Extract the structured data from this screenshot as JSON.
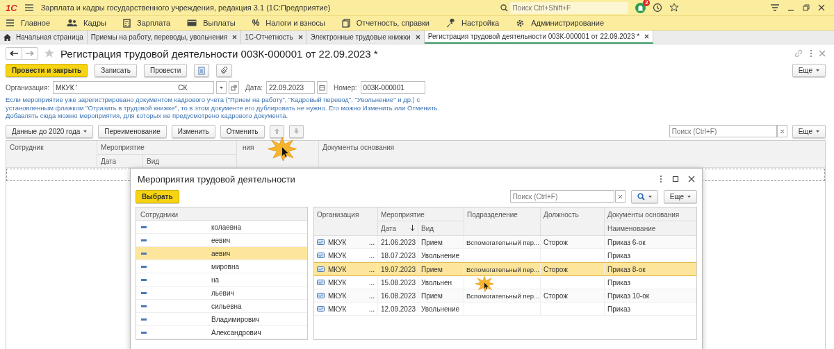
{
  "app": {
    "logo": "1С",
    "title": "Зарплата и кадры государственного учреждения, редакция 3.1  (1С:Предприятие)",
    "search_placeholder": "Поиск Ctrl+Shift+F",
    "notifications": "2"
  },
  "menu": [
    {
      "label": "Главное"
    },
    {
      "label": "Кадры"
    },
    {
      "label": "Зарплата"
    },
    {
      "label": "Выплаты"
    },
    {
      "label": "Налоги и взносы",
      "glyph": "%"
    },
    {
      "label": "Отчетность, справки"
    },
    {
      "label": "Настройка"
    },
    {
      "label": "Администрирование"
    }
  ],
  "tabs": [
    {
      "label": "Начальная страница",
      "selected": false
    },
    {
      "label": "Приемы на работу, переводы, увольнения",
      "selected": false
    },
    {
      "label": "1С-Отчетность",
      "selected": false
    },
    {
      "label": "Электронные трудовые книжки",
      "selected": false
    },
    {
      "label": "Регистрация трудовой деятельности 003К-000001 от 22.09.2023 *",
      "selected": true
    }
  ],
  "form": {
    "title": "Регистрация трудовой деятельности 003К-000001 от 22.09.2023 *",
    "buttons": [
      "Провести и закрыть",
      "Записать",
      "Провести"
    ],
    "more": "Еще",
    "organization": {
      "label": "Организация:",
      "value_start": "МКУК '",
      "value_end": "СК"
    },
    "date": {
      "label": "Дата:",
      "value": "22.09.2023"
    },
    "number": {
      "label": "Номер:",
      "value": "003К-000001"
    },
    "note": "Если мероприятие уже зарегистрировано документом кадрового учета (\"Прием на работу\", \"Кадровый перевод\", \"Увольнение\" и др.) с установленным флажком \"Отразить в трудовой книжке\", то в этом документе его дублировать не нужно. Его можно Изменить или Отменить. Добавлять сюда можно мероприятия, для которых не предусмотрено кадрового документа.",
    "toolbar": [
      "Данные до 2020 года",
      "Переименование",
      "Изменить",
      "Отменить"
    ],
    "search_placeholder": "Поиск (Ctrl+F)",
    "table_more": "Еще",
    "columns": {
      "employee": "Сотрудник",
      "event": "Мероприятие",
      "date": "Дата",
      "kind": "Вид",
      "column_3": "ния",
      "docs": "Документы основания"
    }
  },
  "dialog": {
    "title": "Мероприятия трудовой деятельности",
    "select": "Выбрать",
    "search_placeholder": "Поиск (Ctrl+F)",
    "more": "Еще",
    "employees_header": "Сотрудники",
    "employees": [
      {
        "name": "колаевна",
        "selected": false
      },
      {
        "name": "еевич",
        "selected": false
      },
      {
        "name": "аевич",
        "selected": true
      },
      {
        "name": "мировна",
        "selected": false
      },
      {
        "name": "на",
        "selected": false
      },
      {
        "name": "льевич",
        "selected": false
      },
      {
        "name": "сильевна",
        "selected": false
      },
      {
        "name": "Владимирович",
        "selected": false
      },
      {
        "name": "Александрович",
        "selected": false
      }
    ],
    "columns": {
      "org": "Организация",
      "event": "Мероприятие",
      "date": "Дата",
      "kind": "Вид",
      "dept": "Подразделение",
      "position": "Должность",
      "docs": "Документы основания",
      "doc_name": "Наименование"
    },
    "rows": [
      {
        "org": "МКУК",
        "tail": "...",
        "date": "21.06.2023",
        "kind": "Прием",
        "dept": "Вспомогательный пер...",
        "position": "Сторож",
        "doc": "Приказ 6-ок",
        "selected": false
      },
      {
        "org": "МКУК",
        "tail": "...",
        "date": "18.07.2023",
        "kind": "Увольнение",
        "doc": "Приказ",
        "selected": false
      },
      {
        "org": "МКУК",
        "tail": "...",
        "date": "19.07.2023",
        "kind": "Прием",
        "dept": "Вспомогательный пер...",
        "position": "Сторож",
        "doc": "Приказ 8-ок",
        "selected": true
      },
      {
        "org": "МКУК",
        "tail": "...",
        "date": "15.08.2023",
        "kind": "Увольнен",
        "doc": "Приказ",
        "selected": false
      },
      {
        "org": "МКУК",
        "tail": "...",
        "date": "16.08.2023",
        "kind": "Прием",
        "dept": "Вспомогательный пер...",
        "position": "Сторож",
        "doc": "Приказ 10-ок",
        "selected": false
      },
      {
        "org": "МКУК",
        "tail": "...",
        "date": "12.09.2023",
        "kind": "Увольнение",
        "doc": "Приказ",
        "selected": false
      }
    ]
  }
}
